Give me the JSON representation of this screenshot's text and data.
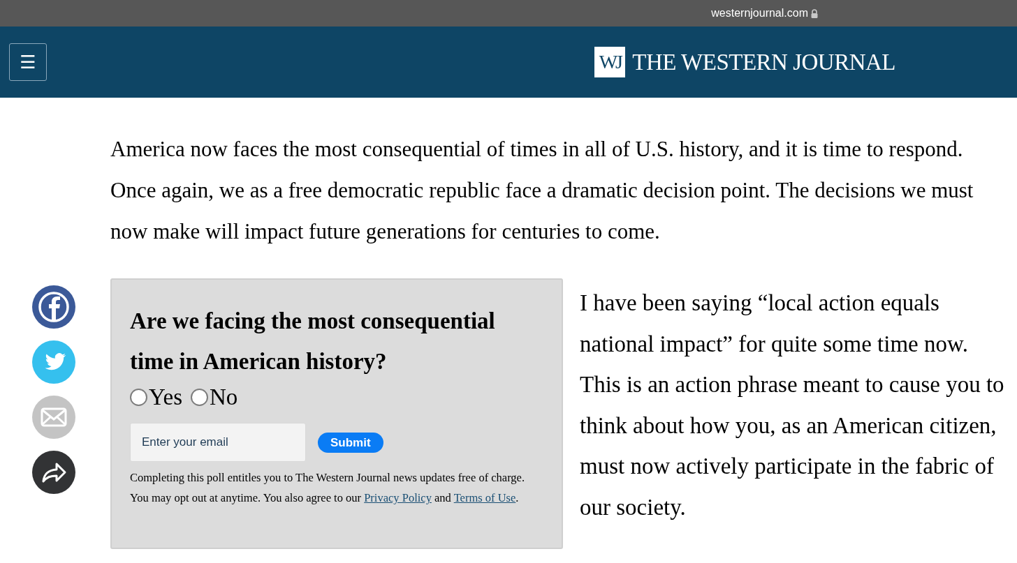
{
  "browser_bar": {
    "url": "westernjournal.com"
  },
  "header": {
    "menu_glyph": "☰",
    "logo_mark": "WJ",
    "logo_text": "THE WESTERN JOURNAL"
  },
  "intro_paragraph": "America now faces the most consequential of times in all of U.S. history, and it is time to respond. Once again, we as a free democratic republic face a dramatic decision point. The decisions we must now make will impact future generations for centuries to come.",
  "share_buttons": [
    {
      "kind": "facebook"
    },
    {
      "kind": "twitter"
    },
    {
      "kind": "email"
    },
    {
      "kind": "share"
    }
  ],
  "poll": {
    "question": "Are we facing the most consequential time in American history?",
    "options": [
      {
        "label": "Yes",
        "selected": false
      },
      {
        "label": "No",
        "selected": false
      }
    ],
    "email_placeholder": "Enter your email",
    "submit": "Submit",
    "disclaimer": {
      "text": "Completing this poll entitles you to The Western Journal news updates free of charge. You may opt out at anytime. You also agree to our",
      "privacy_link": "Privacy Policy",
      "joiner": "and",
      "terms_link": "Terms of Use",
      "end": "."
    }
  },
  "side_paragraph": "I have been saying “local action equals national impact” for quite some time now. This is an action phrase meant to cause you to think about how you, as an American citizen, must now actively participate in the fabric of our society."
}
